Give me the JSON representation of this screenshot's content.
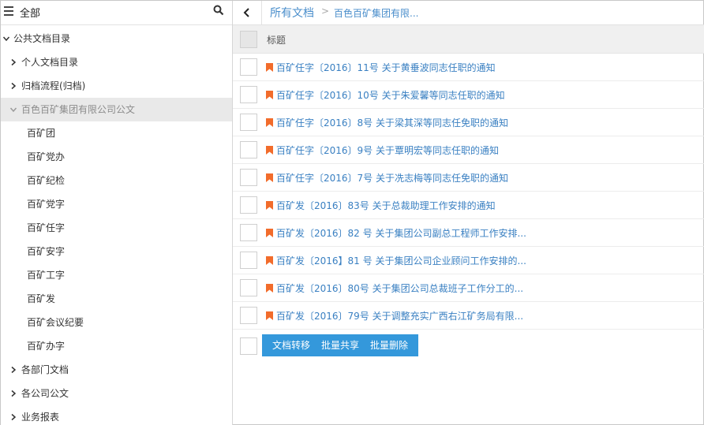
{
  "sidebar": {
    "header": {
      "title": "全部"
    },
    "tree": [
      {
        "label": "公共文档目录",
        "expanded": true,
        "level": 0
      },
      {
        "label": "个人文档目录",
        "expanded": false,
        "level": 1
      },
      {
        "label": "归档流程(归档)",
        "expanded": false,
        "level": 1
      },
      {
        "label": "百色百矿集团有限公司公文",
        "expanded": true,
        "level": 1,
        "active": true
      },
      {
        "label": "百矿团",
        "level": 2
      },
      {
        "label": "百矿党办",
        "level": 2
      },
      {
        "label": "百矿纪检",
        "level": 2
      },
      {
        "label": "百矿党字",
        "level": 2
      },
      {
        "label": "百矿任字",
        "level": 2
      },
      {
        "label": "百矿安字",
        "level": 2
      },
      {
        "label": "百矿工字",
        "level": 2
      },
      {
        "label": "百矿发",
        "level": 2
      },
      {
        "label": "百矿会议纪要",
        "level": 2
      },
      {
        "label": "百矿办字",
        "level": 2
      },
      {
        "label": "各部门文档",
        "expanded": false,
        "level": 1
      },
      {
        "label": "各公司公文",
        "expanded": false,
        "level": 1
      },
      {
        "label": "业务报表",
        "expanded": false,
        "level": 1
      }
    ]
  },
  "breadcrumb": {
    "root": "所有文档",
    "separator": ">",
    "current": "百色百矿集团有限..."
  },
  "table": {
    "header_title": "标题",
    "rows": [
      "百矿任字〔2016〕11号 关于黄垂波同志任职的通知",
      "百矿任字〔2016〕10号 关于朱爱馨等同志任职的通知",
      "百矿任字〔2016〕8号 关于梁其深等同志任免职的通知",
      "百矿任字〔2016〕9号 关于覃明宏等同志任职的通知",
      "百矿任字〔2016〕7号 关于冼志梅等同志任免职的通知",
      "百矿发〔2016〕83号 关于总裁助理工作安排的通知",
      "百矿发〔2016〕82 号 关于集团公司副总工程师工作安排...",
      "百矿发〔2016】81 号 关于集团公司企业顾问工作安排的...",
      "百矿发〔2016〕80号 关于集团公司总裁班子工作分工的...",
      "百矿发〔2016〕79号 关于调整充实广西右江矿务局有限..."
    ]
  },
  "actions": {
    "transfer": "文档转移",
    "batch_share": "批量共享",
    "batch_delete": "批量删除"
  },
  "colors": {
    "link": "#3a80c2",
    "flag": "#f26c2b",
    "button_bg": "#3498db",
    "active_row": "#e9e9e9"
  }
}
